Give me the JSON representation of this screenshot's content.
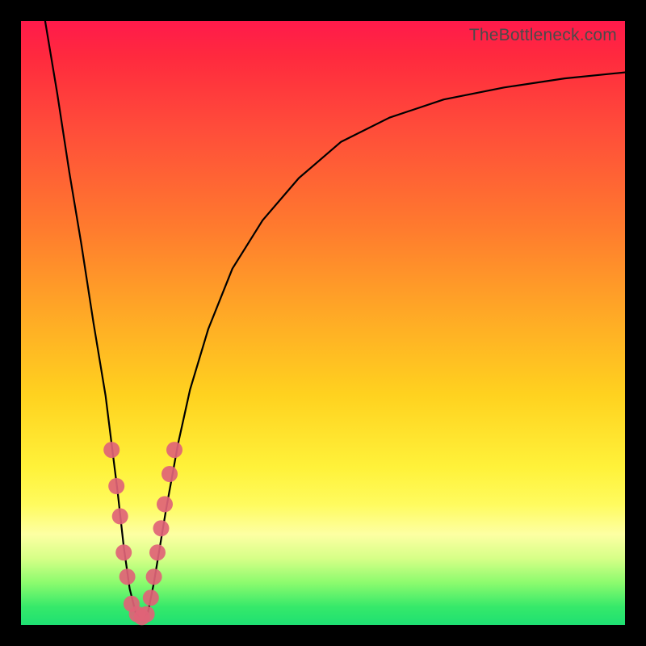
{
  "watermark": "TheBottleneck.com",
  "chart_data": {
    "type": "line",
    "title": "",
    "xlabel": "",
    "ylabel": "",
    "xlim": [
      0,
      100
    ],
    "ylim": [
      0,
      100
    ],
    "series": [
      {
        "name": "bottleneck-curve",
        "x": [
          4,
          6,
          8,
          10,
          12,
          14,
          15,
          16,
          17,
          18,
          19,
          20,
          21,
          22,
          24,
          26,
          28,
          31,
          35,
          40,
          46,
          53,
          61,
          70,
          80,
          90,
          100
        ],
        "values": [
          100,
          88,
          75,
          63,
          50,
          38,
          30,
          22,
          13,
          6,
          2,
          1,
          2,
          7,
          19,
          30,
          39,
          49,
          59,
          67,
          74,
          80,
          84,
          87,
          89,
          90.5,
          91.5
        ]
      }
    ],
    "markers": {
      "name": "highlight-dots",
      "color": "#e06377",
      "points": [
        {
          "x": 15.0,
          "y": 29
        },
        {
          "x": 15.8,
          "y": 23
        },
        {
          "x": 16.4,
          "y": 18
        },
        {
          "x": 17.0,
          "y": 12
        },
        {
          "x": 17.6,
          "y": 8
        },
        {
          "x": 18.3,
          "y": 3.5
        },
        {
          "x": 19.2,
          "y": 1.8
        },
        {
          "x": 20.0,
          "y": 1.3
        },
        {
          "x": 20.8,
          "y": 1.8
        },
        {
          "x": 21.5,
          "y": 4.5
        },
        {
          "x": 22.0,
          "y": 8
        },
        {
          "x": 22.6,
          "y": 12
        },
        {
          "x": 23.2,
          "y": 16
        },
        {
          "x": 23.8,
          "y": 20
        },
        {
          "x": 24.6,
          "y": 25
        },
        {
          "x": 25.4,
          "y": 29
        }
      ]
    },
    "gradient_stops": [
      {
        "pos": 0,
        "color": "#ff1a4b"
      },
      {
        "pos": 18,
        "color": "#ff4d3a"
      },
      {
        "pos": 48,
        "color": "#ffa726"
      },
      {
        "pos": 74,
        "color": "#fff23a"
      },
      {
        "pos": 100,
        "color": "#1ee072"
      }
    ]
  }
}
